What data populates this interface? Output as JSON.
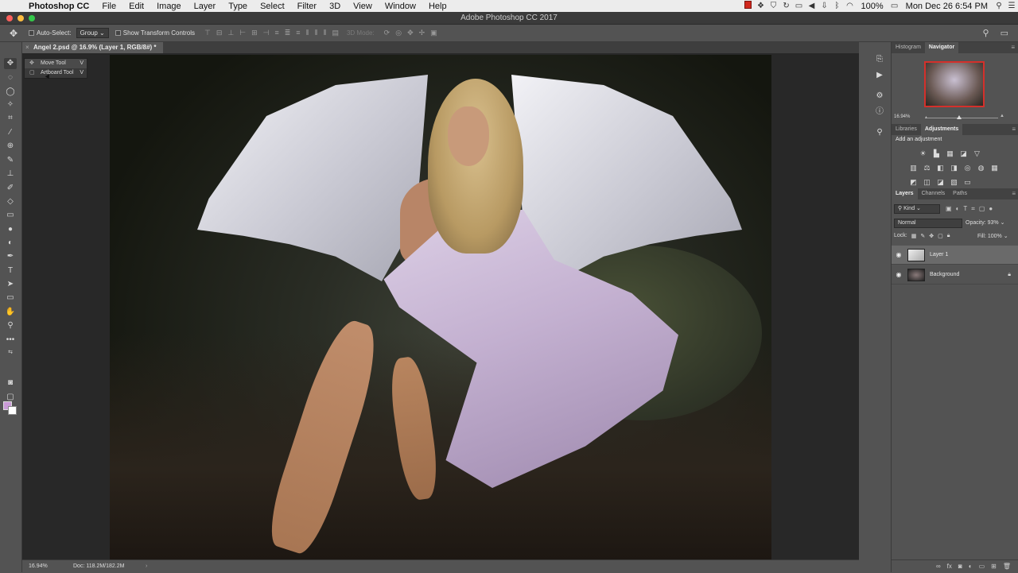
{
  "menubar": {
    "app": "Photoshop CC",
    "items": [
      "File",
      "Edit",
      "Image",
      "Layer",
      "Type",
      "Select",
      "Filter",
      "3D",
      "View",
      "Window",
      "Help"
    ],
    "battery": "100%",
    "clock": "Mon Dec 26  6:54 PM"
  },
  "window": {
    "title": "Adobe Photoshop CC 2017"
  },
  "options": {
    "auto_select_label": "Auto-Select:",
    "auto_select_value": "Group",
    "transform_label": "Show Transform Controls",
    "mode_3d": "3D Mode:"
  },
  "document": {
    "tab_title": "Angel 2.psd @ 16.9% (Layer 1, RGB/8#) *"
  },
  "flyout": {
    "items": [
      {
        "label": "Move Tool",
        "key": "V"
      },
      {
        "label": "Artboard Tool",
        "key": "V"
      }
    ]
  },
  "status": {
    "zoom": "16.94%",
    "doc": "Doc: 118.2M/182.2M",
    "arrow": "›"
  },
  "navigator": {
    "tabs": [
      "Histogram",
      "Navigator"
    ],
    "zoom": "16.94%"
  },
  "adjustments": {
    "tabs": [
      "Libraries",
      "Adjustments"
    ],
    "title": "Add an adjustment"
  },
  "layers_panel": {
    "tabs": [
      "Layers",
      "Channels",
      "Paths"
    ],
    "kind": "Kind",
    "blend_mode": "Normal",
    "opacity_label": "Opacity:",
    "opacity_value": "93%",
    "lock_label": "Lock:",
    "fill_label": "Fill:",
    "fill_value": "100%",
    "layers": [
      {
        "name": "Layer 1",
        "selected": true
      },
      {
        "name": "Background",
        "locked": true
      }
    ]
  },
  "colors": {
    "foreground": "#c99ad6",
    "background": "#ffffff",
    "panel": "#535353",
    "canvas_bg": "#282828"
  }
}
